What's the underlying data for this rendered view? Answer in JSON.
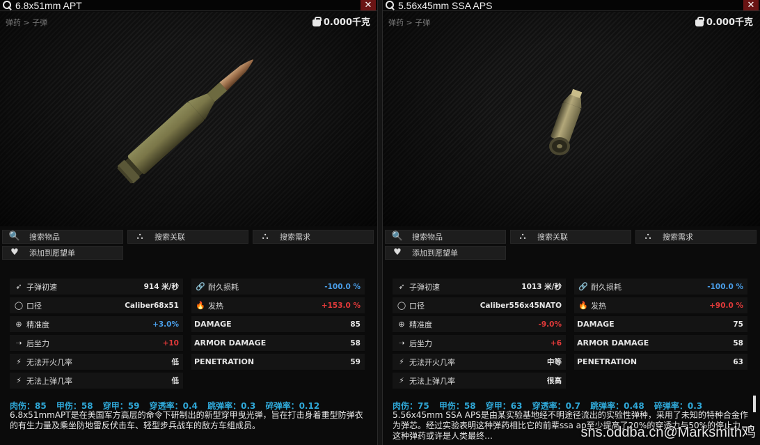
{
  "left": {
    "title": "6.8x51mm APT",
    "close": "✕",
    "breadcrumb": "弹药 > 子弹",
    "weight": "0.000千克",
    "actions": {
      "search_item": "搜索物品",
      "search_related": "搜索关联",
      "search_needs": "搜索需求",
      "add_wishlist": "添加到愿望单"
    },
    "stats_left": [
      {
        "label": "子弹初速",
        "value": "914 米/秒",
        "icon": "bullet-icon"
      },
      {
        "label": "口径",
        "value": "Caliber68x51",
        "icon": "caliber-icon"
      },
      {
        "label": "精准度",
        "value": "+3.0%",
        "icon": "accuracy-icon",
        "tone": "blue"
      },
      {
        "label": "后坐力",
        "value": "+10",
        "icon": "recoil-icon",
        "tone": "red"
      },
      {
        "label": "无法开火几率",
        "value": "低",
        "icon": "misfire-icon"
      },
      {
        "label": "无法上弹几率",
        "value": "低",
        "icon": "misfeed-icon"
      }
    ],
    "stats_right": [
      {
        "label": "耐久损耗",
        "value": "-100.0 %",
        "icon": "durability-icon",
        "tone": "blue"
      },
      {
        "label": "发热",
        "value": "+153.0 %",
        "icon": "heat-icon",
        "tone": "red"
      },
      {
        "label": "DAMAGE",
        "value": "85"
      },
      {
        "label": "ARMOR DAMAGE",
        "value": "58"
      },
      {
        "label": "PENETRATION",
        "value": "59"
      }
    ],
    "summary": [
      "肉伤：85",
      "甲伤：58",
      "穿甲：59",
      "穿透率：0.4",
      "跳弹率：0.3",
      "碎弹率：0.12"
    ],
    "description": "6.8x51mmAPT是在美国军方高层的命令下研制出的新型穿甲曳光弹，旨在打击身着重型防弹衣的有生力量及乘坐防地雷反伏击车、轻型步兵战车的敌方车组成员。"
  },
  "right": {
    "title": "5.56x45mm SSA APS",
    "close": "✕",
    "breadcrumb": "弹药 > 子弹",
    "weight": "0.000千克",
    "actions": {
      "search_item": "搜索物品",
      "search_related": "搜索关联",
      "search_needs": "搜索需求",
      "add_wishlist": "添加到愿望单"
    },
    "stats_left": [
      {
        "label": "子弹初速",
        "value": "1013 米/秒",
        "icon": "bullet-icon"
      },
      {
        "label": "口径",
        "value": "Caliber556x45NATO",
        "icon": "caliber-icon"
      },
      {
        "label": "精准度",
        "value": "-9.0%",
        "icon": "accuracy-icon",
        "tone": "red"
      },
      {
        "label": "后坐力",
        "value": "+6",
        "icon": "recoil-icon",
        "tone": "red"
      },
      {
        "label": "无法开火几率",
        "value": "中等",
        "icon": "misfire-icon"
      },
      {
        "label": "无法上弹几率",
        "value": "很高",
        "icon": "misfeed-icon"
      }
    ],
    "stats_right": [
      {
        "label": "耐久损耗",
        "value": "-100.0 %",
        "icon": "durability-icon",
        "tone": "blue"
      },
      {
        "label": "发热",
        "value": "+90.0 %",
        "icon": "heat-icon",
        "tone": "red"
      },
      {
        "label": "DAMAGE",
        "value": "75"
      },
      {
        "label": "ARMOR DAMAGE",
        "value": "58"
      },
      {
        "label": "PENETRATION",
        "value": "63"
      }
    ],
    "summary": [
      "肉伤：75",
      "甲伤：58",
      "穿甲：63",
      "穿透率：0.7",
      "跳弹率：0.48",
      "碎弹率：0.3"
    ],
    "description": "5.56x45mm SSA APS是由某实验基地经不明途径流出的实验性弹种，采用了未知的特种合金作为弹芯。经过实验表明这种弹药相比它的前辈ssa ap至少提高了20%的穿透力与50%的停止力，这种弹药或许是人类最终…"
  },
  "watermark": "sns.oddba.cn@Marksmith鸡"
}
